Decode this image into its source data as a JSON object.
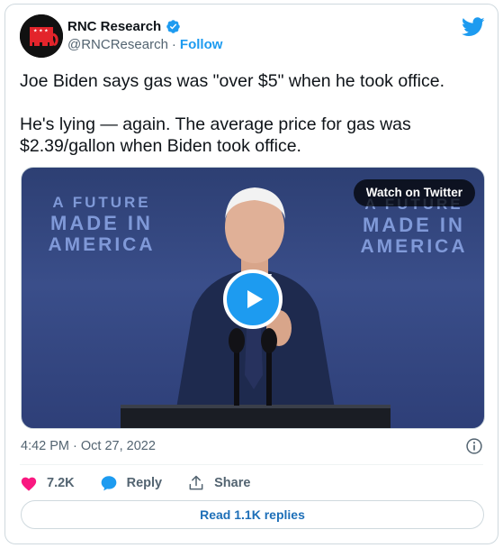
{
  "author": {
    "name": "RNC Research",
    "handle": "@RNCResearch",
    "separator": "·",
    "follow_label": "Follow"
  },
  "tweet": {
    "paragraph1": "Joe Biden says gas was \"over $5\" when he took office.",
    "paragraph2": "He's lying — again. The average price for gas was $2.39/gallon when Biden took office."
  },
  "media": {
    "watch_label": "Watch on Twitter",
    "backdrop_left": [
      "A FUTURE",
      "MADE IN",
      "AMERICA"
    ],
    "backdrop_right": [
      "A FUTURE",
      "MADE IN",
      "AMERICA"
    ]
  },
  "meta": {
    "timestamp": "4:42 PM · Oct 27, 2022"
  },
  "actions": {
    "likes": "7.2K",
    "reply_label": "Reply",
    "share_label": "Share"
  },
  "footer": {
    "read_replies": "Read 1.1K replies"
  },
  "colors": {
    "accent": "#1d9bf0",
    "like": "#f91880",
    "text": "#0f1419",
    "secondary": "#536471"
  },
  "icons": [
    "rnc-elephant-logo",
    "verified-icon",
    "twitter-bird-icon",
    "play-icon",
    "info-icon",
    "heart-icon",
    "reply-bubble-icon",
    "share-icon"
  ]
}
